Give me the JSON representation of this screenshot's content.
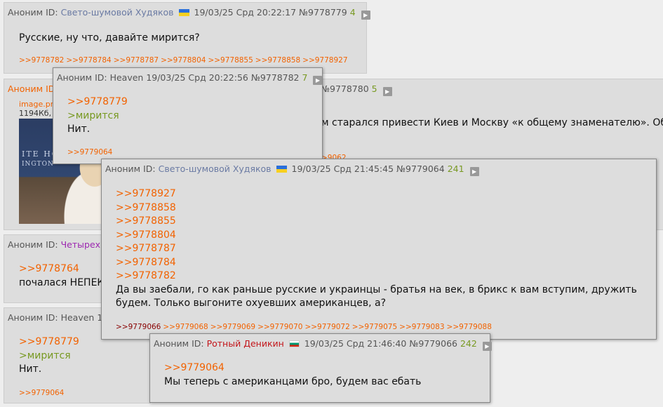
{
  "posts": {
    "p1": {
      "anon": "Аноним ID:",
      "name": "Свето-шумовой Худяков",
      "date": "19/03/25 Срд 20:22:17",
      "num": "№9778779",
      "count": "4",
      "text": "Русские, ну что, давайте мирится?",
      "replies": [
        ">>9778782",
        ">>9778784",
        ">>9778787",
        ">>9778804",
        ">>9778855",
        ">>9778858",
        ">>9778927"
      ]
    },
    "p2": {
      "anon": "Аноним ID",
      "num": "№9778780",
      "count": "5",
      "image_link": "image.pn",
      "image_meta": "1194Кб, 1",
      "thumb_text1": "ITE HO",
      "thumb_text2": "INGTON",
      "text": "м старался привести Киев и Москву «к общему знаменателю». Об это",
      "reply_frag": ">9062"
    },
    "p3": {
      "anon": "Аноним ID:",
      "name": "Четырехм",
      "quote_link": ">>9778764",
      "text": "почалася НЕПЕКА"
    },
    "p4": {
      "anon": "Аноним ID: Heaven",
      "date_frag": "19",
      "quote_link": ">>9778779",
      "quote": ">мирится",
      "text": "Нит.",
      "replies": [
        ">>9779064"
      ]
    }
  },
  "previews": {
    "pv1": {
      "anon": "Аноним ID: Heaven",
      "date": "19/03/25 Срд 20:22:56",
      "num": "№9778782",
      "count": "7",
      "quote_link": ">>9778779",
      "quote": ">мирится",
      "text": "Нит.",
      "replies": [
        ">>9779064"
      ]
    },
    "pv2": {
      "anon": "Аноним ID:",
      "name": "Свето-шумовой Худяков",
      "date": "19/03/25 Срд 21:45:45",
      "num": "№9779064",
      "count": "241",
      "links": [
        ">>9778927",
        ">>9778858",
        ">>9778855",
        ">>9778804",
        ">>9778787",
        ">>9778784",
        ">>9778782"
      ],
      "text": "Да вы заебали, го как раньше русские и украинцы - братья на век, в брикс к вам вступим, дружить будем. Только выгоните охуевших американцев, а?",
      "replies": [
        ">>9779066",
        ">>9779068",
        ">>9779069",
        ">>9779070",
        ">>9779072",
        ">>9779075",
        ">>9779083",
        ">>9779088"
      ]
    },
    "pv3": {
      "anon": "Аноним ID:",
      "name": "Ротный Деникин",
      "date": "19/03/25 Срд 21:46:40",
      "num": "№9779066",
      "count": "242",
      "quote_link": ">>9779064",
      "text": "Мы теперь с американцами бро, будем вас ебать"
    }
  },
  "colors": {
    "link": "#f26200",
    "quote": "#789922",
    "background": "#eeeeee",
    "post": "#dddddd"
  },
  "icons": {
    "play": "play-triangle-icon",
    "flag_ua": "ukraine-flag-icon",
    "flag_bg": "bulgaria-flag-icon"
  }
}
